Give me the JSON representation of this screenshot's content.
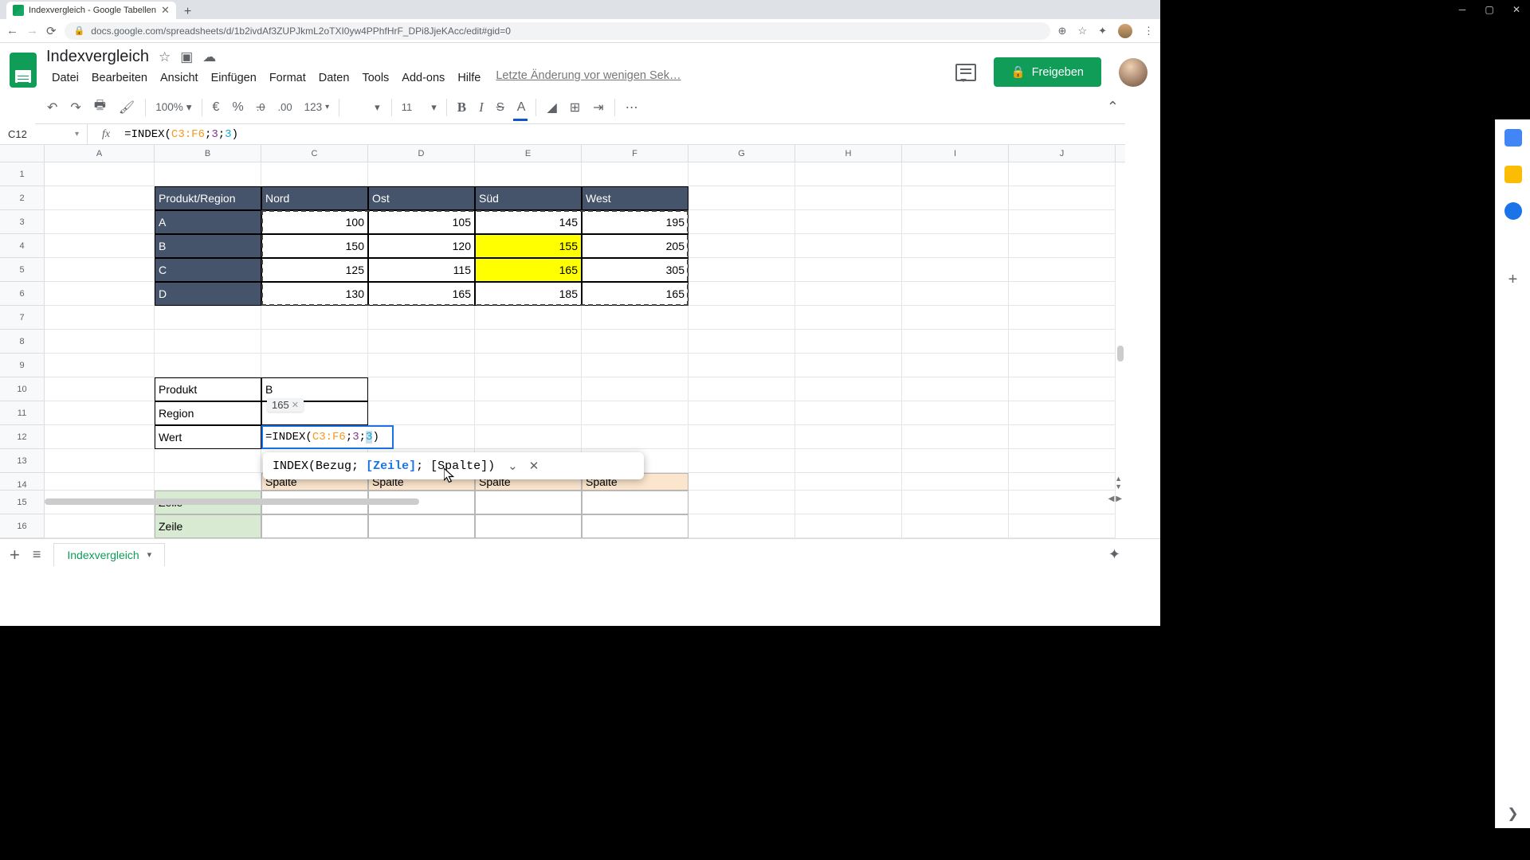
{
  "browser": {
    "tab_title": "Indexvergleich - Google Tabellen",
    "url": "docs.google.com/spreadsheets/d/1b2ivdAf3ZUPJkmL2oTXI0yw4PPhfHrF_DPi8JjeKAcc/edit#gid=0"
  },
  "doc": {
    "title": "Indexvergleich",
    "last_change": "Letzte Änderung vor wenigen Sek…",
    "share": "Freigeben"
  },
  "menu": {
    "datei": "Datei",
    "bearbeiten": "Bearbeiten",
    "ansicht": "Ansicht",
    "einfuegen": "Einfügen",
    "format": "Format",
    "daten": "Daten",
    "tools": "Tools",
    "addons": "Add-ons",
    "hilfe": "Hilfe"
  },
  "toolbar": {
    "zoom": "100%",
    "euro": "€",
    "percent": "%",
    "dec_dec": ".0",
    "dec_inc": ".00",
    "num_fmt": "123",
    "font_size": "11"
  },
  "name_box": "C12",
  "formula": {
    "prefix": "=INDEX(",
    "range": "C3:F6",
    "sep1": ";",
    "row": "3",
    "sep2": ";",
    "col": "3",
    "suffix": ")"
  },
  "columns": [
    "A",
    "B",
    "C",
    "D",
    "E",
    "F",
    "G",
    "H",
    "I",
    "J"
  ],
  "table": {
    "corner": "Produkt/Region",
    "regions": [
      "Nord",
      "Ost",
      "Süd",
      "West"
    ],
    "rows": [
      {
        "label": "A",
        "vals": [
          "100",
          "105",
          "145",
          "195"
        ]
      },
      {
        "label": "B",
        "vals": [
          "150",
          "120",
          "155",
          "205"
        ]
      },
      {
        "label": "C",
        "vals": [
          "125",
          "115",
          "165",
          "305"
        ]
      },
      {
        "label": "D",
        "vals": [
          "130",
          "165",
          "185",
          "165"
        ]
      }
    ]
  },
  "lookup": {
    "produkt_lbl": "Produkt",
    "produkt_val": "B",
    "region_lbl": "Region",
    "region_val": "",
    "wert_lbl": "Wert"
  },
  "preview": "165",
  "help": {
    "fn": "INDEX",
    "open": "(",
    "a1": "Bezug",
    "s1": "; ",
    "a2": "[Zeile]",
    "s2": "; ",
    "a3": "[Spalte]",
    "close": ")"
  },
  "second_table": {
    "col_hdr": "Spalte",
    "row_hdr": "Zeile"
  },
  "sheet_tab": "Indexvergleich"
}
